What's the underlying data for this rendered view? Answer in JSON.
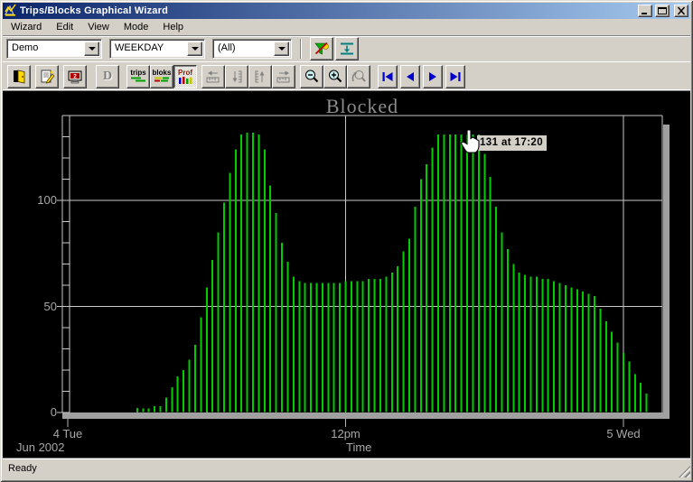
{
  "window": {
    "title": "Trips/Blocks Graphical Wizard",
    "controls": [
      {
        "name": "minimize"
      },
      {
        "name": "maximize"
      },
      {
        "name": "close"
      }
    ]
  },
  "menu": {
    "items": [
      {
        "label": "Wizard"
      },
      {
        "label": "Edit"
      },
      {
        "label": "View"
      },
      {
        "label": "Mode"
      },
      {
        "label": "Help"
      }
    ]
  },
  "combo_toolbar": {
    "combos": [
      {
        "name": "dataset",
        "value": "Demo"
      },
      {
        "name": "day-type",
        "value": "WEEKDAY"
      },
      {
        "name": "route-filter",
        "value": "(All)"
      }
    ]
  },
  "toolbar": {
    "d_label": "D",
    "trips_label": "trips",
    "bloks_label": "bloks",
    "prof_label": "Prof"
  },
  "icons": {
    "app": "wizard-chart",
    "filter": "funnel-ball-red-slash",
    "collapse": "arrow-down-between-lines",
    "exit": "open-door",
    "properties": "sheet-with-pencil",
    "screen2": "monitor-number-2",
    "shift_left": "arrow-left-ruler",
    "shift_down": "arrow-down-bracket",
    "shift_up": "bracket-arrow-up",
    "shift_right": "ruler-arrow-right",
    "zoom_out": "magnifier-minus",
    "zoom_in": "magnifier-plus",
    "zoom_back": "magnifier-undo-arrow",
    "nav_first": "bar-left-triangle",
    "nav_prev": "left-triangle",
    "nav_next": "right-triangle",
    "nav_last": "right-triangle-bar"
  },
  "chart_data": {
    "type": "bar",
    "title": "Blocked",
    "xlabel": "Time",
    "date_label": "Jun 2002",
    "background": "#000000",
    "bar_color": "#00cc00",
    "grid_color": "#c8c8c8",
    "axis_shadow_color": "#a0a0a0",
    "ylim": [
      0,
      140
    ],
    "xlim_minutes": [
      0,
      1540
    ],
    "x_ticks": [
      {
        "label": "4 Tue",
        "minutes": 0
      },
      {
        "label": "12pm",
        "minutes": 720
      },
      {
        "label": "5 Wed",
        "minutes": 1440
      }
    ],
    "y_ticks": [
      {
        "label": "0",
        "value": 0
      },
      {
        "label": "50",
        "value": 50
      },
      {
        "label": "100",
        "value": 100
      }
    ],
    "y_gridlines": [
      50,
      100
    ],
    "x_gridlines_minutes": [
      720,
      1440
    ],
    "minor_y_tick_interval": 10,
    "minor_x_tick_interval_minutes": 180,
    "bar_interval_minutes": 15,
    "tooltip": {
      "text": "131 at 17:20",
      "value": 131,
      "time": "17:20"
    },
    "points": [
      [
        180,
        2
      ],
      [
        195,
        2
      ],
      [
        210,
        2
      ],
      [
        225,
        3
      ],
      [
        240,
        3
      ],
      [
        255,
        7
      ],
      [
        270,
        12
      ],
      [
        285,
        17
      ],
      [
        300,
        20
      ],
      [
        315,
        25
      ],
      [
        330,
        32
      ],
      [
        345,
        45
      ],
      [
        360,
        59
      ],
      [
        375,
        72
      ],
      [
        390,
        85
      ],
      [
        405,
        99
      ],
      [
        420,
        113
      ],
      [
        435,
        124
      ],
      [
        450,
        131
      ],
      [
        465,
        132
      ],
      [
        480,
        132
      ],
      [
        495,
        131
      ],
      [
        510,
        124
      ],
      [
        525,
        107
      ],
      [
        540,
        94
      ],
      [
        555,
        80
      ],
      [
        570,
        71
      ],
      [
        585,
        64
      ],
      [
        600,
        62
      ],
      [
        615,
        61
      ],
      [
        630,
        61
      ],
      [
        645,
        61
      ],
      [
        660,
        61
      ],
      [
        675,
        61
      ],
      [
        690,
        61
      ],
      [
        705,
        61
      ],
      [
        720,
        62
      ],
      [
        735,
        62
      ],
      [
        750,
        62
      ],
      [
        765,
        62
      ],
      [
        780,
        63
      ],
      [
        795,
        63
      ],
      [
        810,
        63
      ],
      [
        825,
        64
      ],
      [
        840,
        66
      ],
      [
        855,
        69
      ],
      [
        870,
        76
      ],
      [
        885,
        82
      ],
      [
        900,
        97
      ],
      [
        915,
        110
      ],
      [
        930,
        117
      ],
      [
        945,
        125
      ],
      [
        960,
        131
      ],
      [
        975,
        131
      ],
      [
        990,
        131
      ],
      [
        1005,
        131
      ],
      [
        1020,
        131
      ],
      [
        1035,
        131
      ],
      [
        1050,
        131
      ],
      [
        1065,
        131
      ],
      [
        1080,
        122
      ],
      [
        1095,
        111
      ],
      [
        1110,
        97
      ],
      [
        1125,
        85
      ],
      [
        1140,
        77
      ],
      [
        1155,
        70
      ],
      [
        1170,
        66
      ],
      [
        1185,
        65
      ],
      [
        1200,
        64
      ],
      [
        1215,
        64
      ],
      [
        1230,
        63
      ],
      [
        1245,
        63
      ],
      [
        1260,
        62
      ],
      [
        1275,
        61
      ],
      [
        1290,
        60
      ],
      [
        1305,
        59
      ],
      [
        1320,
        58
      ],
      [
        1335,
        57
      ],
      [
        1350,
        56
      ],
      [
        1365,
        55
      ],
      [
        1380,
        49
      ],
      [
        1395,
        43
      ],
      [
        1410,
        38
      ],
      [
        1425,
        33
      ],
      [
        1440,
        28
      ],
      [
        1455,
        24
      ],
      [
        1470,
        18
      ],
      [
        1485,
        14
      ],
      [
        1500,
        9
      ]
    ]
  },
  "status_bar": {
    "text": "Ready"
  }
}
